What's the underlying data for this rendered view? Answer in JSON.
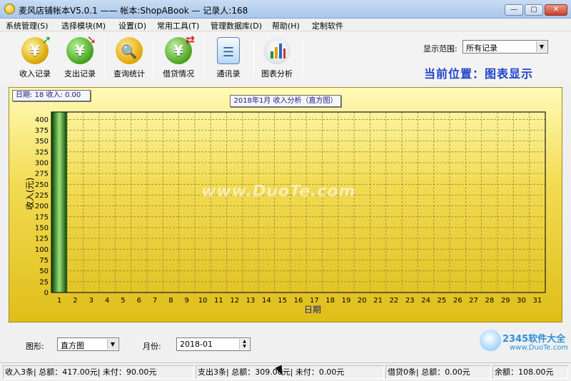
{
  "window": {
    "title": "麦风店铺帐本V5.0.1  ——  帐本:ShopABook — 记录人:168",
    "buttons": [
      "—",
      "▢",
      "✕"
    ]
  },
  "menu": [
    "系统管理(S)",
    "选择模块(M)",
    "设置(D)",
    "常用工具(T)",
    "管理数据库(D)",
    "帮助(H)",
    "定制软件"
  ],
  "toolbar": {
    "items": [
      {
        "label": "收入记录",
        "glyph": "¥",
        "icon": "income-icon"
      },
      {
        "label": "支出记录",
        "glyph": "¥",
        "icon": "expense-icon"
      },
      {
        "label": "查询统计",
        "glyph": "🔍",
        "icon": "query-icon"
      },
      {
        "label": "借贷情况",
        "glyph": "¥",
        "icon": "loan-icon"
      },
      {
        "label": "通讯录",
        "glyph": "☰",
        "icon": "contacts-icon"
      },
      {
        "label": "图表分析",
        "glyph": "▮",
        "icon": "chart-analysis-icon"
      }
    ],
    "range_label": "显示范围:",
    "range_value": "所有记录",
    "location": "当前位置：图表显示"
  },
  "chart_panel": {
    "info": "日期:  18  收入:  0.00",
    "watermark": "www.DuoTe.com"
  },
  "chart_data": {
    "type": "bar",
    "title": "2018年1月 收入分析（直方图）",
    "xlabel": "日期",
    "ylabel": "收入(元)",
    "categories": [
      "1",
      "2",
      "3",
      "4",
      "5",
      "6",
      "7",
      "8",
      "9",
      "10",
      "11",
      "12",
      "13",
      "14",
      "15",
      "16",
      "17",
      "18",
      "19",
      "20",
      "21",
      "22",
      "23",
      "24",
      "25",
      "26",
      "27",
      "28",
      "29",
      "30",
      "31"
    ],
    "values": [
      417,
      0,
      0,
      0,
      0,
      0,
      0,
      0,
      0,
      0,
      0,
      0,
      0,
      0,
      0,
      0,
      0,
      0,
      0,
      0,
      0,
      0,
      0,
      0,
      0,
      0,
      0,
      0,
      0,
      0,
      0
    ],
    "ylim": [
      0,
      417
    ],
    "yticks": [
      0,
      25,
      50,
      75,
      100,
      125,
      150,
      175,
      200,
      225,
      250,
      275,
      300,
      325,
      350,
      375,
      400
    ],
    "grid": true,
    "colors": {
      "bar_dark": "#0a4d0a",
      "bar_light": "#9fe07a",
      "grid": "#8f8a3a",
      "axis": "#1a1a1a"
    }
  },
  "controls": {
    "shape_label": "图形:",
    "shape_value": "直方图",
    "month_label": "月份:",
    "month_value": "2018-01"
  },
  "status": [
    "收入3条| 总额：417.00元| 未付：90.00元",
    "支出3条| 总额：309.00元| 未付：0.00元",
    "借贷0条| 总额：0.00元",
    "余额：108.00元"
  ],
  "brand": {
    "main": "2345软件大全",
    "sub": "www.DuoTe.com"
  }
}
